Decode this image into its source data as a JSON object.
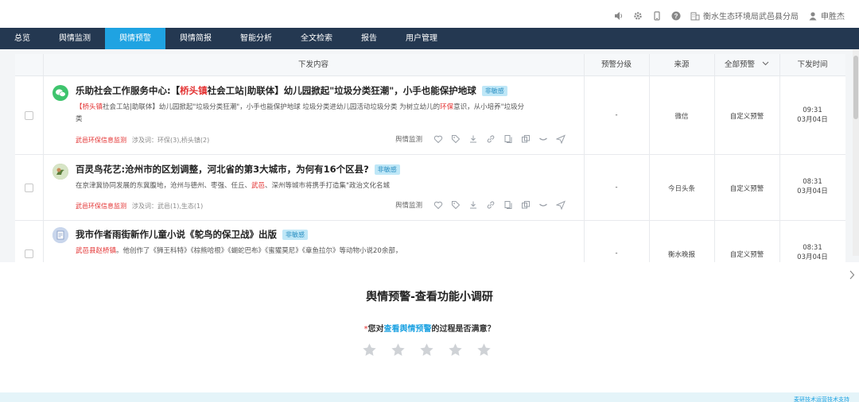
{
  "topbar": {
    "org": "衡水生态环境局武邑县分局",
    "user": "申胜杰",
    "icons": [
      "volume-icon",
      "gear-icon",
      "mobile-icon",
      "help-icon",
      "building-icon",
      "user-icon"
    ]
  },
  "nav": [
    "总览",
    "舆情监测",
    "舆情预警",
    "舆情简报",
    "智能分析",
    "全文检索",
    "报告",
    "用户管理"
  ],
  "nav_active": "舆情预警",
  "table": {
    "headers": {
      "content": "下发内容",
      "level": "预警分级",
      "source": "来源",
      "type": "全部预警",
      "time": "下发时间"
    },
    "rows": [
      {
        "title_pre": "乐助社会工作服务中心:【",
        "title_hl": "桥头镇",
        "title_post": "社会工站|助联体】幼儿园掀起\"垃圾分类狂潮\"，小手也能保护地球",
        "badge": "非敏感",
        "summary_hl1": "【桥头镇",
        "summary_mid": "社会工站|助联体】幼儿园掀起\"垃圾分类狂潮\"，小手也能保护地球 垃圾分类进幼儿园活动垃圾分类 为树立幼儿的",
        "summary_hl2": "环保",
        "summary_post": "意识，从小培养\"垃圾分类",
        "meta_source": "武邑环保信息监测",
        "meta_keywords": "涉及词：环保(3),桥头镇(2)",
        "action_label": "舆情监测",
        "level": "-",
        "source": "微信",
        "type": "自定义预警",
        "time": "09:31",
        "date": "03月04日"
      },
      {
        "title": "百灵鸟花艺:沧州市的区划调整，河北省的第3大城市，为何有16个区县?",
        "badge": "非敏感",
        "summary_pre": "在京津冀协同发展的东冀腹地，沧州与德州、枣强、任丘、",
        "summary_hl": "武邑",
        "summary_post": "、深州等城市将携手打造集\"政治文化名城",
        "meta_source": "武邑环保信息监测",
        "meta_keywords": "涉及词：武邑(1),生态(1)",
        "action_label": "舆情监测",
        "level": "-",
        "source": "今日头条",
        "type": "自定义预警",
        "time": "08:31",
        "date": "03月04日"
      },
      {
        "title": "我市作者雨街新作儿童小说《鸵鸟的保卫战》出版",
        "badge": "非敏感",
        "summary_hl": "武邑县赵桥镇",
        "summary_post": "。他创作了《狮王科特》《棕熊哈根》《蝴蛇巴布》《蜜獾莫尼》《章鱼拉尔》等动物小说20余部，",
        "level": "-",
        "source": "衡水晚报",
        "type": "自定义预警",
        "time": "08:31",
        "date": "03月04日"
      }
    ]
  },
  "survey": {
    "title": "舆情预警-查看功能小调研",
    "required_mark": "*",
    "q_pre": "您对",
    "q_link": "查看舆情预警",
    "q_post": "的过程是否满意？",
    "star_count": 5,
    "star_color": "#cfd2d6"
  },
  "footer": {
    "text": "麦研技术运营技术支持"
  },
  "colors": {
    "nav_bg": "#243851",
    "nav_active": "#1fa3e2",
    "highlight": "#e33131"
  }
}
